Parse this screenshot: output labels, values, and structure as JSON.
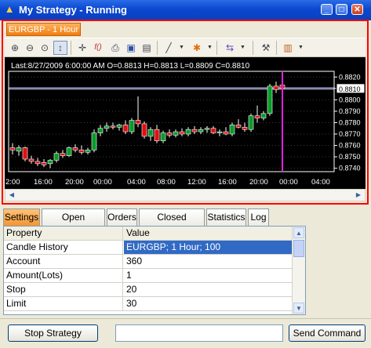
{
  "window": {
    "title": "My Strategy - Running",
    "app_icon": "strategy-app-icon",
    "controls": [
      "_",
      "□",
      "✕"
    ]
  },
  "chart": {
    "tab_label": "EURGBP - 1 Hour",
    "info_line": "Last:8/27/2009 6:00:00 AM O=0.8813 H=0.8813 L=0.8809 C=0.8810",
    "toolbar_icons": [
      "zoom-in-icon",
      "zoom-out-icon",
      "zoom-fit-icon",
      "cursor-icon",
      "crosshair-icon",
      "function-icon",
      "print-icon",
      "save-icon",
      "export-icon",
      "line-tool-icon",
      "marker-tool-icon",
      "object-list-icon",
      "indicators-icon",
      "chart-type-icon"
    ],
    "colors": {
      "background": "#000000",
      "bull": "#0a9a2a",
      "bear": "#e01010",
      "grid": "#3a3a3a",
      "axis_frame": "#ffffff",
      "current_bar_line": "#e020e0",
      "price_line": "#8a8ab0"
    }
  },
  "chart_data": {
    "type": "candlestick",
    "symbol": "EURGBP",
    "interval": "1 Hour",
    "x_tick_labels": [
      "2:00",
      "16:00",
      "20:00",
      "00:00",
      "04:00",
      "08:00",
      "12:00",
      "16:00",
      "20:00",
      "00:00",
      "04:00"
    ],
    "y_tick_labels": [
      "0.8820",
      "0.8810",
      "0.8800",
      "0.8790",
      "0.8780",
      "0.8770",
      "0.8760",
      "0.8750",
      "0.8740"
    ],
    "ylim": [
      0.8737,
      0.8825
    ],
    "current_price": "0.8810",
    "candles": [
      {
        "o": 0.8758,
        "h": 0.8762,
        "l": 0.8752,
        "c": 0.8756
      },
      {
        "o": 0.8755,
        "h": 0.876,
        "l": 0.8751,
        "c": 0.8758
      },
      {
        "o": 0.8758,
        "h": 0.8759,
        "l": 0.8746,
        "c": 0.8748
      },
      {
        "o": 0.8748,
        "h": 0.8751,
        "l": 0.8744,
        "c": 0.8746
      },
      {
        "o": 0.8746,
        "h": 0.8749,
        "l": 0.8742,
        "c": 0.8744
      },
      {
        "o": 0.8745,
        "h": 0.8748,
        "l": 0.8741,
        "c": 0.8743
      },
      {
        "o": 0.8744,
        "h": 0.8748,
        "l": 0.874,
        "c": 0.8747
      },
      {
        "o": 0.8747,
        "h": 0.8755,
        "l": 0.8745,
        "c": 0.8753
      },
      {
        "o": 0.8753,
        "h": 0.8756,
        "l": 0.8749,
        "c": 0.8751
      },
      {
        "o": 0.8751,
        "h": 0.8759,
        "l": 0.875,
        "c": 0.8758
      },
      {
        "o": 0.8758,
        "h": 0.8761,
        "l": 0.8754,
        "c": 0.8756
      },
      {
        "o": 0.8756,
        "h": 0.876,
        "l": 0.8752,
        "c": 0.8754
      },
      {
        "o": 0.8754,
        "h": 0.8758,
        "l": 0.8752,
        "c": 0.8756
      },
      {
        "o": 0.8756,
        "h": 0.8774,
        "l": 0.8754,
        "c": 0.8771
      },
      {
        "o": 0.8771,
        "h": 0.8778,
        "l": 0.8768,
        "c": 0.8775
      },
      {
        "o": 0.8775,
        "h": 0.878,
        "l": 0.8772,
        "c": 0.8777
      },
      {
        "o": 0.8777,
        "h": 0.878,
        "l": 0.8774,
        "c": 0.8776
      },
      {
        "o": 0.8776,
        "h": 0.8779,
        "l": 0.8773,
        "c": 0.8778
      },
      {
        "o": 0.8778,
        "h": 0.8782,
        "l": 0.877,
        "c": 0.8772
      },
      {
        "o": 0.8772,
        "h": 0.8784,
        "l": 0.877,
        "c": 0.8782
      },
      {
        "o": 0.8782,
        "h": 0.8803,
        "l": 0.8776,
        "c": 0.8779
      },
      {
        "o": 0.8779,
        "h": 0.8781,
        "l": 0.8766,
        "c": 0.8768
      },
      {
        "o": 0.8768,
        "h": 0.8776,
        "l": 0.8764,
        "c": 0.8774
      },
      {
        "o": 0.8774,
        "h": 0.8778,
        "l": 0.8762,
        "c": 0.8764
      },
      {
        "o": 0.8764,
        "h": 0.8773,
        "l": 0.8762,
        "c": 0.8771
      },
      {
        "o": 0.8771,
        "h": 0.8774,
        "l": 0.8767,
        "c": 0.8769
      },
      {
        "o": 0.8769,
        "h": 0.8774,
        "l": 0.8767,
        "c": 0.8772
      },
      {
        "o": 0.8772,
        "h": 0.8775,
        "l": 0.8768,
        "c": 0.877
      },
      {
        "o": 0.877,
        "h": 0.8776,
        "l": 0.8768,
        "c": 0.8774
      },
      {
        "o": 0.8774,
        "h": 0.8777,
        "l": 0.877,
        "c": 0.8772
      },
      {
        "o": 0.8772,
        "h": 0.8776,
        "l": 0.877,
        "c": 0.8774
      },
      {
        "o": 0.8774,
        "h": 0.8777,
        "l": 0.8771,
        "c": 0.8775
      },
      {
        "o": 0.8775,
        "h": 0.8777,
        "l": 0.877,
        "c": 0.8771
      },
      {
        "o": 0.8771,
        "h": 0.8774,
        "l": 0.8768,
        "c": 0.8772
      },
      {
        "o": 0.8772,
        "h": 0.8776,
        "l": 0.8769,
        "c": 0.877
      },
      {
        "o": 0.877,
        "h": 0.878,
        "l": 0.8768,
        "c": 0.8778
      },
      {
        "o": 0.8778,
        "h": 0.8783,
        "l": 0.8775,
        "c": 0.8776
      },
      {
        "o": 0.8776,
        "h": 0.878,
        "l": 0.8772,
        "c": 0.8774
      },
      {
        "o": 0.8774,
        "h": 0.8788,
        "l": 0.8772,
        "c": 0.8786
      },
      {
        "o": 0.8786,
        "h": 0.8795,
        "l": 0.878,
        "c": 0.8784
      },
      {
        "o": 0.8784,
        "h": 0.879,
        "l": 0.8782,
        "c": 0.8788
      },
      {
        "o": 0.8788,
        "h": 0.8814,
        "l": 0.8786,
        "c": 0.8812
      },
      {
        "o": 0.8812,
        "h": 0.8816,
        "l": 0.8806,
        "c": 0.8809
      },
      {
        "o": 0.8813,
        "h": 0.8813,
        "l": 0.8809,
        "c": 0.881
      }
    ]
  },
  "panel": {
    "tabs": [
      "Settings",
      "Open Positions",
      "Orders",
      "Closed Positions",
      "Statistics",
      "Log"
    ],
    "active_tab": "Settings",
    "columns": [
      "Property",
      "Value"
    ],
    "rows": [
      {
        "property": "Candle History",
        "value": "EURGBP; 1 Hour; 100"
      },
      {
        "property": "Account",
        "value": "360"
      },
      {
        "property": "Amount(Lots)",
        "value": "1"
      },
      {
        "property": "Stop",
        "value": "20"
      },
      {
        "property": "Limit",
        "value": "30"
      }
    ]
  },
  "footer": {
    "stop_label": "Stop Strategy",
    "command_value": "",
    "send_label": "Send Command"
  }
}
